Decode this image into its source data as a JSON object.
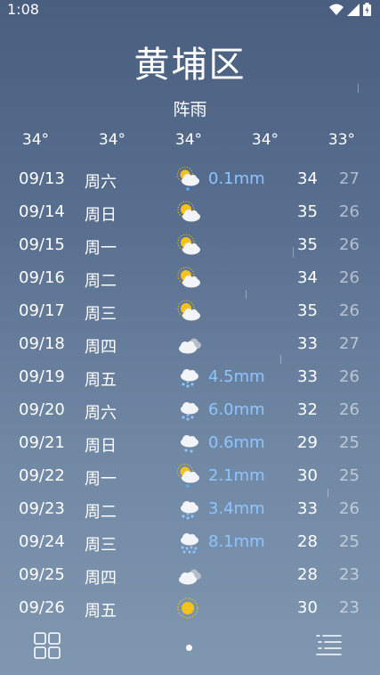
{
  "status": {
    "time": "1:08"
  },
  "location": {
    "city": "黄埔区",
    "condition": "阵雨"
  },
  "hourly_temps": [
    "34°",
    "34°",
    "34°",
    "34°",
    "33°"
  ],
  "forecast": [
    {
      "date": "09/13",
      "weekday": "周六",
      "icon": "light-rain-sun-icon",
      "precip": "0.1mm",
      "high": "34",
      "low": "27"
    },
    {
      "date": "09/14",
      "weekday": "周日",
      "icon": "partly-cloudy-icon",
      "precip": "",
      "high": "35",
      "low": "26"
    },
    {
      "date": "09/15",
      "weekday": "周一",
      "icon": "partly-cloudy-icon",
      "precip": "",
      "high": "35",
      "low": "26"
    },
    {
      "date": "09/16",
      "weekday": "周二",
      "icon": "partly-cloudy-icon",
      "precip": "",
      "high": "34",
      "low": "26"
    },
    {
      "date": "09/17",
      "weekday": "周三",
      "icon": "partly-cloudy-icon",
      "precip": "",
      "high": "35",
      "low": "26"
    },
    {
      "date": "09/18",
      "weekday": "周四",
      "icon": "cloudy-icon",
      "precip": "",
      "high": "33",
      "low": "27"
    },
    {
      "date": "09/19",
      "weekday": "周五",
      "icon": "rain-icon",
      "precip": "4.5mm",
      "high": "33",
      "low": "26"
    },
    {
      "date": "09/20",
      "weekday": "周六",
      "icon": "rain-icon",
      "precip": "6.0mm",
      "high": "32",
      "low": "26"
    },
    {
      "date": "09/21",
      "weekday": "周日",
      "icon": "light-rain-icon",
      "precip": "0.6mm",
      "high": "29",
      "low": "25"
    },
    {
      "date": "09/22",
      "weekday": "周一",
      "icon": "light-rain-sun-icon",
      "precip": "2.1mm",
      "high": "30",
      "low": "25"
    },
    {
      "date": "09/23",
      "weekday": "周二",
      "icon": "rain-icon",
      "precip": "3.4mm",
      "high": "33",
      "low": "26"
    },
    {
      "date": "09/24",
      "weekday": "周三",
      "icon": "heavy-rain-icon",
      "precip": "8.1mm",
      "high": "28",
      "low": "25"
    },
    {
      "date": "09/25",
      "weekday": "周四",
      "icon": "cloudy-icon",
      "precip": "",
      "high": "28",
      "low": "23"
    },
    {
      "date": "09/26",
      "weekday": "周五",
      "icon": "sunny-icon",
      "precip": "",
      "high": "30",
      "low": "23"
    }
  ]
}
